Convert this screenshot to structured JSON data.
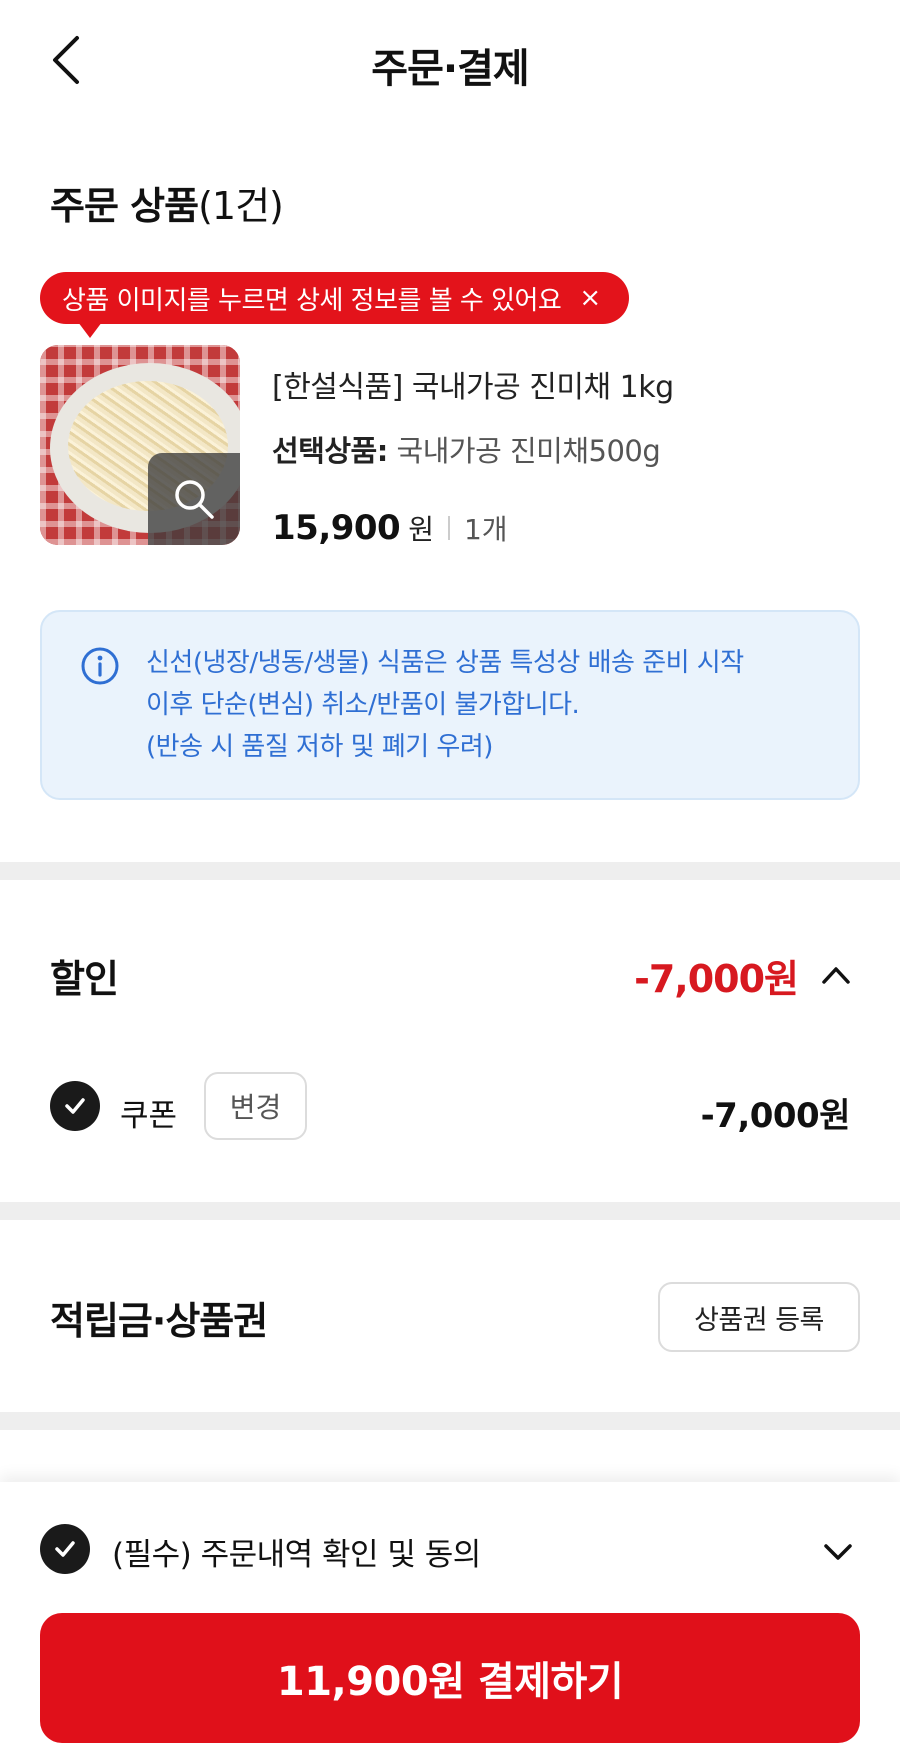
{
  "header": {
    "title": "주문·결제",
    "back_icon": "chevron-left-icon"
  },
  "order_products": {
    "title": "주문 상품",
    "count": "(1건)",
    "tooltip": "상품 이미지를 누르면 상세 정보를 볼 수 있어요",
    "tooltip_close": "×",
    "item": {
      "name": "[한설식품] 국내가공 진미채 1kg",
      "option_label": "선택상품:",
      "option_value": "국내가공 진미채500g",
      "price": "15,900",
      "price_unit": "원",
      "quantity": "1개",
      "thumb_icon": "magnifier-icon"
    }
  },
  "notice": {
    "icon": "info-icon",
    "lines": [
      "신선(냉장/냉동/생물) 식품은 상품 특성상 배송 준비 시작",
      "이후 단순(변심) 취소/반품이 불가합니다.",
      "(반송 시 품질 저하 및 폐기 우려)"
    ]
  },
  "discount": {
    "title": "할인",
    "total": "-7,000원",
    "coupon_label": "쿠폰",
    "change_label": "변경",
    "coupon_amount": "-7,000원"
  },
  "points": {
    "title": "적립금·상품권",
    "register_label": "상품권 등록"
  },
  "footer": {
    "agree_label": "(필수) 주문내역 확인 및 동의",
    "pay_label": "11,900원 결제하기"
  },
  "colors": {
    "accent_red": "#e0101a",
    "discount_red": "#d71920",
    "notice_blue": "#2f6fd3",
    "notice_bg": "#eaf3fc"
  }
}
